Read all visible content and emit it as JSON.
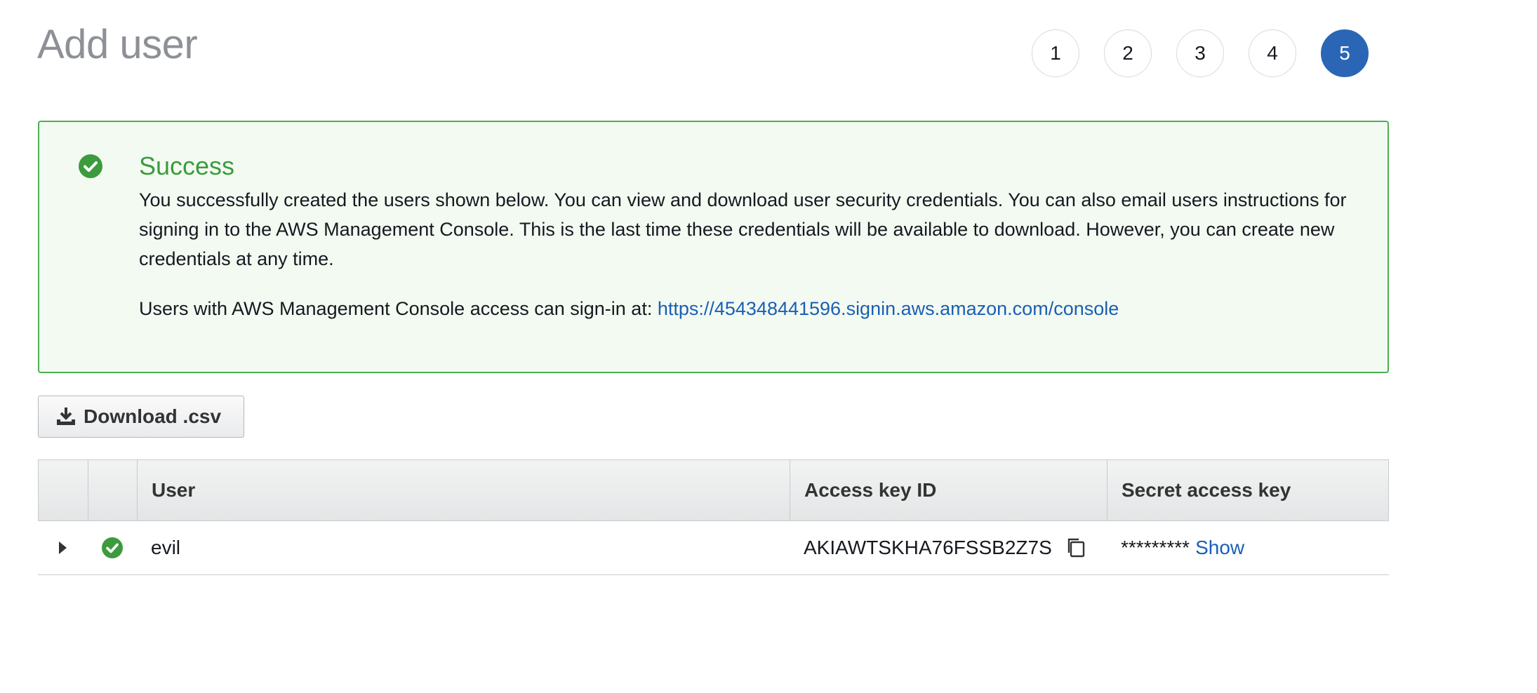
{
  "page": {
    "title": "Add user"
  },
  "steps": [
    "1",
    "2",
    "3",
    "4",
    "5"
  ],
  "active_step": 5,
  "alert": {
    "title": "Success",
    "body": "You successfully created the users shown below. You can view and download user security credentials. You can also email users instructions for signing in to the AWS Management Console. This is the last time these credentials will be available to download. However, you can create new credentials at any time.",
    "signin_prefix": "Users with AWS Management Console access can sign-in at: ",
    "signin_url": "https://454348441596.signin.aws.amazon.com/console",
    "icon": "check-circle-icon",
    "color": "#3c9b3c"
  },
  "toolbar": {
    "download_label": "Download .csv",
    "download_icon": "download-icon"
  },
  "table": {
    "columns": [
      "",
      "",
      "User",
      "Access key ID",
      "Secret access key"
    ],
    "rows": [
      {
        "user": "evil",
        "access_key_id": "AKIAWTSKHA76FSSB2Z7S",
        "secret_mask": "*********",
        "show_label": "Show",
        "status_icon": "check-circle-icon"
      }
    ]
  },
  "colors": {
    "accent": "#2b66b6",
    "link": "#1a5fb4",
    "success_border": "#4caf50",
    "success_bg": "#f3faf2"
  }
}
